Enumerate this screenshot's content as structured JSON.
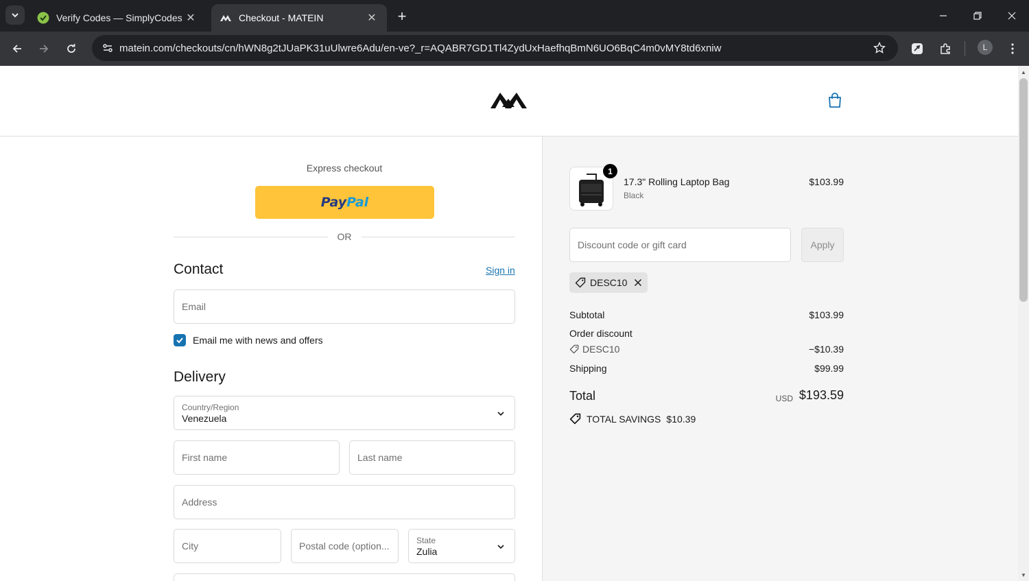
{
  "browser": {
    "tabs": [
      {
        "title": "Verify Codes — SimplyCodes",
        "icon": "simplycodes-favicon",
        "active": false
      },
      {
        "title": "Checkout - MATEIN",
        "icon": "matein-favicon",
        "active": true
      }
    ],
    "url": "matein.com/checkouts/cn/hWN8g2tJUaPK31uUlwre6Adu/en-ve?_r=AQABR7GD1Tl4ZydUxHaefhqBmN6UO6BqC4m0vMY8td6xniw",
    "profile_initial": "L"
  },
  "express": {
    "label": "Express checkout",
    "paypal_pay": "Pay",
    "paypal_pal": "Pal",
    "or_label": "OR"
  },
  "contact": {
    "title": "Contact",
    "sign_in": "Sign in",
    "email_placeholder": "Email",
    "newsletter_label": "Email me with news and offers",
    "newsletter_checked": true
  },
  "delivery": {
    "title": "Delivery",
    "country_label": "Country/Region",
    "country_value": "Venezuela",
    "first_name_placeholder": "First name",
    "last_name_placeholder": "Last name",
    "address_placeholder": "Address",
    "city_placeholder": "City",
    "postal_placeholder": "Postal code (option...",
    "state_label": "State",
    "state_value": "Zulia"
  },
  "order": {
    "item": {
      "name": "17.3\" Rolling Laptop Bag",
      "variant": "Black",
      "price": "$103.99",
      "quantity": "1"
    },
    "discount_placeholder": "Discount code or gift card",
    "apply_label": "Apply",
    "applied_code": "DESC10",
    "subtotal_label": "Subtotal",
    "subtotal_value": "$103.99",
    "order_discount_label": "Order discount",
    "discount_code": "DESC10",
    "discount_value": "−$10.39",
    "shipping_label": "Shipping",
    "shipping_value": "$99.99",
    "total_label": "Total",
    "currency": "USD",
    "total_value": "$193.59",
    "savings_label": "TOTAL SAVINGS",
    "savings_value": "$10.39"
  },
  "colors": {
    "accent_link": "#1773b0",
    "paypal_yellow": "#ffc439",
    "summary_bg": "#f5f5f5"
  }
}
